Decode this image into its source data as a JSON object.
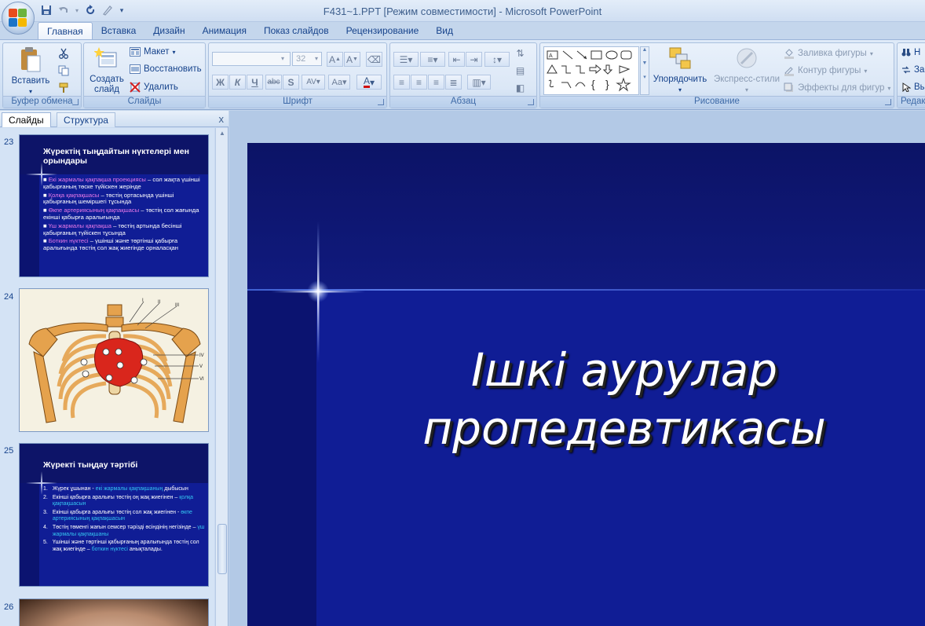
{
  "app": {
    "title": "F431~1.PPT [Режим совместимости] - Microsoft PowerPoint"
  },
  "ribbon_tabs": [
    "Главная",
    "Вставка",
    "Дизайн",
    "Анимация",
    "Показ слайдов",
    "Рецензирование",
    "Вид"
  ],
  "active_tab": "Главная",
  "groups": {
    "clipboard": {
      "label": "Буфер обмена",
      "paste": "Вставить"
    },
    "slides": {
      "label": "Слайды",
      "new_slide_1": "Создать",
      "new_slide_2": "слайд",
      "layout": "Макет",
      "reset": "Восстановить",
      "delete": "Удалить"
    },
    "font": {
      "label": "Шрифт",
      "font_name": "",
      "font_size": "32"
    },
    "paragraph": {
      "label": "Абзац"
    },
    "drawing": {
      "label": "Рисование",
      "arrange": "Упорядочить",
      "quick_styles": "Экспресс-стили",
      "fill": "Заливка фигуры",
      "outline": "Контур фигуры",
      "effects": "Эффекты для фигур"
    },
    "editing": {
      "label": "Редак",
      "find": "Н",
      "replace": "За",
      "select": "Вы"
    }
  },
  "pane": {
    "tabs": [
      "Слайды",
      "Структура"
    ],
    "close": "x"
  },
  "thumbnails": [
    {
      "number": "23",
      "title": "Жүректің тыңдайтын нүктелері мен орындары",
      "bullets": [
        {
          "highlight": "Екі жармалы қақпақша проекциясы",
          "rest": " – сол жақта үшінші қабырғаның төске түйіскен жерінде"
        },
        {
          "highlight": "Қолқа қақпақшасы",
          "rest": " – төстің ортасында үшінші қабырғаның шеміршегі тұсында"
        },
        {
          "highlight": "Өкпе артериясының қақпақшасы",
          "rest": " – төстің сол жағында екінші қабырға аралығында"
        },
        {
          "highlight": "Үш жармалы қақпақша",
          "rest": " – төстің артында бесінші қабырғаның түйіскен тұсында"
        },
        {
          "highlight": "Боткин нүктесі",
          "rest": " – үшінші және төртінші қабырға аралығында төстің сол жақ жиегінде орналасқан"
        }
      ]
    },
    {
      "number": "24",
      "labels": [
        "I",
        "II",
        "III",
        "IV",
        "V",
        "VI"
      ]
    },
    {
      "number": "25",
      "title": "Жүректі тыңдау тәртібі",
      "items": [
        {
          "n": "1.",
          "text": "Жүрек ұшынан - ",
          "highlight": "екі жармалы қақпақшаның",
          "tail": " дыбысын"
        },
        {
          "n": "2.",
          "text": "Екінші қабырға аралығы төстің оң жақ жиегінен – ",
          "highlight": "қолқа қақпақшасын",
          "tail": ""
        },
        {
          "n": "3.",
          "text": "Екінші қабырға аралығы төстің сол жақ жиегінен - ",
          "highlight": "өкпе артериясының қақпақшасын",
          "tail": ""
        },
        {
          "n": "4.",
          "text": "Төстің төменгі жағын семсер тәрізді өсіндінің негізінде – ",
          "highlight": "үш жармалы қақпақшаны",
          "tail": ""
        },
        {
          "n": "5.",
          "text": "Үшінші және төртінші қабырғаның аралығында төстің сол жақ жиегінде – ",
          "highlight": "боткин нүктесі",
          "tail": " анықталады."
        }
      ]
    },
    {
      "number": "26"
    }
  ],
  "current_slide": {
    "title_line1": "Ішкі аурулар",
    "title_line2": "пропедевтикасы"
  },
  "colors": {
    "slide_bg": "#101d95",
    "highlight_pink": "#e878e8",
    "highlight_cyan": "#34c4f0"
  }
}
